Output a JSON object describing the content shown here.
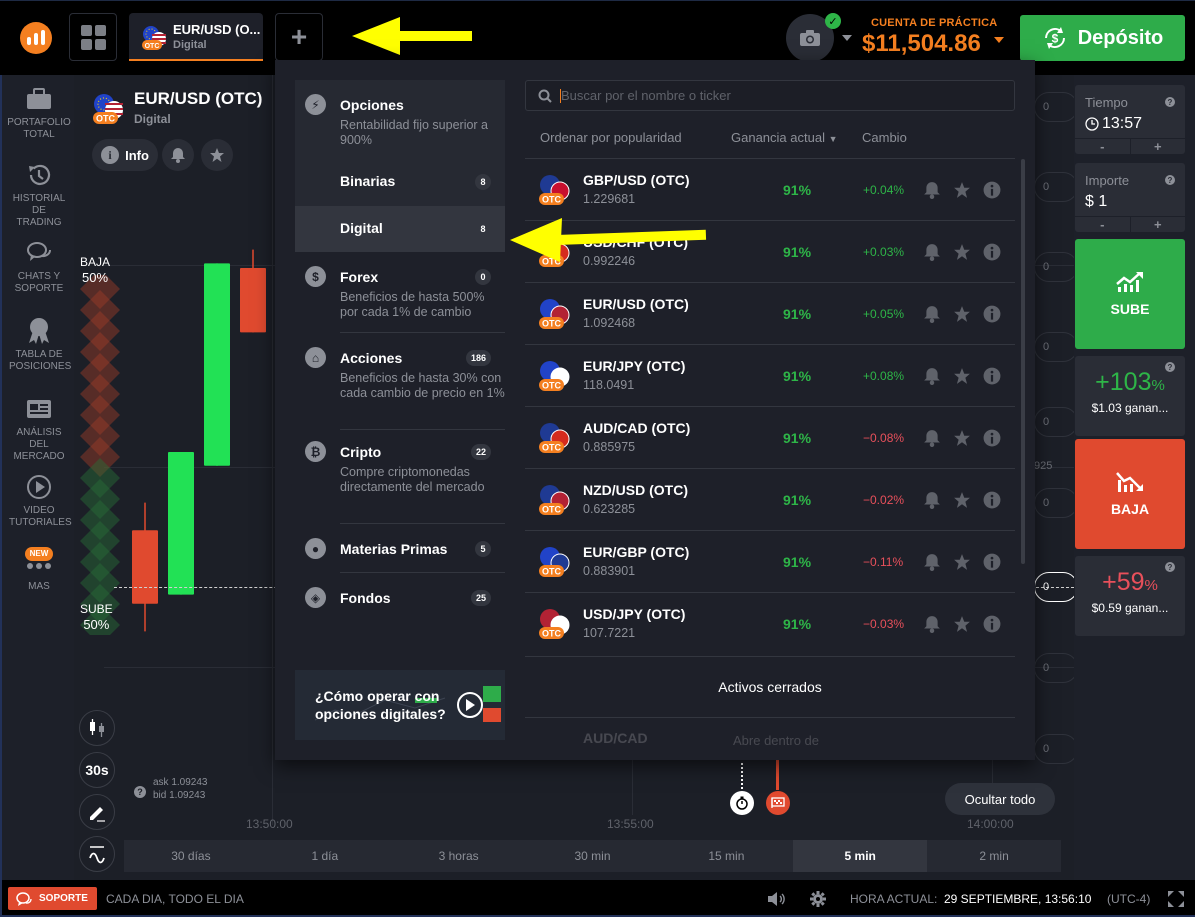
{
  "topbar": {
    "asset_tab": {
      "name": "EUR/USD (O...",
      "type": "Digital",
      "badge": "OTC"
    },
    "add_tab_label": "+",
    "account_label": "CUENTA DE PRÁCTICA",
    "balance": "$11,504.86",
    "deposit_label": "Depósito"
  },
  "sidebar": {
    "items": [
      {
        "label": "PORTAFOLIO TOTAL",
        "icon": "briefcase-icon"
      },
      {
        "label": "HISTORIAL DE TRADING",
        "icon": "history-icon"
      },
      {
        "label": "CHATS Y SOPORTE",
        "icon": "chat-icon"
      },
      {
        "label": "TABLA DE POSICIONES",
        "icon": "medal-icon"
      },
      {
        "label": "ANÁLISIS DEL MERCADO",
        "icon": "newspaper-icon"
      },
      {
        "label": "VIDEO TUTORIALES",
        "icon": "play-icon"
      },
      {
        "label": "MAS",
        "icon": "more-icon",
        "badge": "NEW"
      }
    ]
  },
  "chart_panel": {
    "asset_name": "EUR/USD (OTC)",
    "asset_type": "Digital",
    "otc_badge": "OTC",
    "info_label": "Info",
    "sentiment_down": {
      "label": "BAJA",
      "value": "50%"
    },
    "sentiment_up": {
      "label": "SUBE",
      "value": "50%"
    },
    "candle_interval": "30s",
    "ask": "ask 1.09243",
    "bid": "bid 1.09243",
    "time_labels": [
      "13:50:00",
      "13:55:00",
      "14:00:00"
    ],
    "price_fragment": "925",
    "periods": [
      "30 días",
      "1 día",
      "3 horas",
      "30 min",
      "15 min",
      "5 min",
      "2 min"
    ],
    "active_period": "5 min",
    "hide_all_label": "Ocultar todo",
    "candles": [
      {
        "dir": "down",
        "open": 0.62,
        "close": 0.78,
        "high": 0.56,
        "low": 0.84
      },
      {
        "dir": "up",
        "open": 0.76,
        "close": 0.45,
        "high": 0.45,
        "low": 0.76
      },
      {
        "dir": "up",
        "open": 0.48,
        "close": 0.04,
        "high": 0.04,
        "low": 0.48
      },
      {
        "dir": "down",
        "open": 0.05,
        "close": 0.19,
        "high": 0.01,
        "low": 0.19
      }
    ]
  },
  "asset_picker": {
    "categories": [
      {
        "title": "Opciones",
        "desc": "Rentabilidad fijo superior a 900%",
        "icon": "bolt-icon"
      },
      {
        "title": "Binarias",
        "count": "8",
        "sub": true
      },
      {
        "title": "Digital",
        "count": "8",
        "sub": true,
        "active": true
      },
      {
        "title": "Forex",
        "count": "0",
        "desc": "Beneficios de hasta 500% por cada 1% de cambio",
        "icon": "dollar-icon"
      },
      {
        "title": "Acciones",
        "count": "186",
        "desc": "Beneficios de hasta 30% con cada cambio de precio en 1%",
        "icon": "bank-icon"
      },
      {
        "title": "Cripto",
        "count": "22",
        "desc": "Compre criptomonedas directamente del mercado",
        "icon": "bitcoin-icon"
      },
      {
        "title": "Materias Primas",
        "count": "5",
        "icon": "drop-icon"
      },
      {
        "title": "Fondos",
        "count": "25",
        "icon": "box-icon"
      }
    ],
    "video_card": "¿Cómo operar con opciones digitales?",
    "search_placeholder": "Buscar por el nombre o ticker",
    "search_value": "",
    "columns": {
      "sort": "Ordenar por popularidad",
      "profit": "Ganancia actual",
      "change": "Cambio"
    },
    "assets": [
      {
        "name": "GBP/USD (OTC)",
        "price": "1.229681",
        "profit": "91%",
        "change": "+0.04%",
        "trend": "pos",
        "flags": [
          "#1f3a93",
          "#c8102e"
        ]
      },
      {
        "name": "USD/CHF (OTC)",
        "price": "0.992246",
        "profit": "91%",
        "change": "+0.03%",
        "trend": "pos",
        "flags": [
          "#b22234",
          "#d52b1e"
        ]
      },
      {
        "name": "EUR/USD (OTC)",
        "price": "1.092468",
        "profit": "91%",
        "change": "+0.05%",
        "trend": "pos",
        "flags": [
          "#2143c8",
          "#b22234"
        ]
      },
      {
        "name": "EUR/JPY (OTC)",
        "price": "118.0491",
        "profit": "91%",
        "change": "+0.08%",
        "trend": "pos",
        "flags": [
          "#2143c8",
          "#ffffff"
        ]
      },
      {
        "name": "AUD/CAD (OTC)",
        "price": "0.885975",
        "profit": "91%",
        "change": "−0.08%",
        "trend": "neg",
        "flags": [
          "#1f3a93",
          "#d52b1e"
        ]
      },
      {
        "name": "NZD/USD (OTC)",
        "price": "0.623285",
        "profit": "91%",
        "change": "−0.02%",
        "trend": "neg",
        "flags": [
          "#1f3a93",
          "#b22234"
        ]
      },
      {
        "name": "EUR/GBP (OTC)",
        "price": "0.883901",
        "profit": "91%",
        "change": "−0.11%",
        "trend": "neg",
        "flags": [
          "#2143c8",
          "#1f3a93"
        ]
      },
      {
        "name": "USD/JPY (OTC)",
        "price": "107.7221",
        "profit": "91%",
        "change": "−0.03%",
        "trend": "neg",
        "flags": [
          "#b22234",
          "#ffffff"
        ]
      }
    ],
    "closed_label": "Activos cerrados",
    "closed_assets": [
      {
        "name": "AUD/CAD",
        "status": "Abre dentro de"
      }
    ]
  },
  "trade_panel": {
    "time_label": "Tiempo",
    "time_value": "13:57",
    "amount_label": "Importe",
    "amount_value": "$ 1",
    "minus": "-",
    "plus": "+",
    "up_label": "SUBE",
    "up_payout": "+103",
    "up_amount": "$1.03 ganan...",
    "down_label": "BAJA",
    "down_payout": "+59",
    "down_amount": "$0.59 ganan...",
    "pct": "%"
  },
  "footer": {
    "support_label": "SOPORTE",
    "support_hours": "CADA DIA, TODO EL DIA",
    "time_label": "HORA ACTUAL:",
    "time_value": "29 SEPTIEMBRE, 13:56:10",
    "timezone": "(UTC-4)"
  },
  "colors": {
    "accent": "#f47f20",
    "up": "#2eb548",
    "down": "#e04a2f",
    "candle_up": "#22e155",
    "candle_down": "#e04a2f"
  }
}
